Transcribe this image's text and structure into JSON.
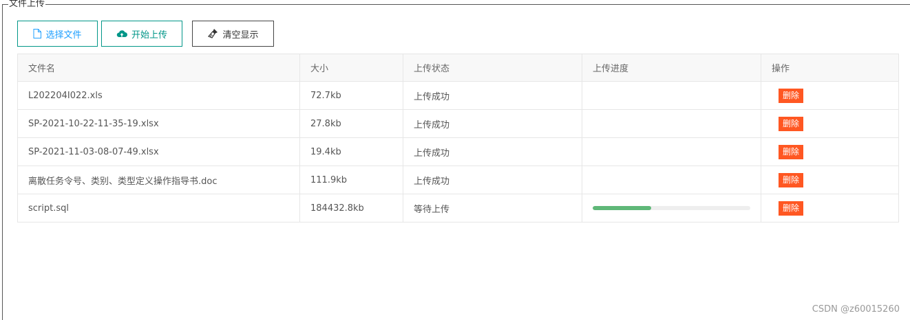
{
  "fieldset": {
    "legend": "文件上传"
  },
  "toolbar": {
    "select_label": "选择文件",
    "start_label": "开始上传",
    "clear_label": "清空显示"
  },
  "table": {
    "headers": [
      "文件名",
      "大小",
      "上传状态",
      "上传进度",
      "操作"
    ],
    "rows": [
      {
        "name": "L202204I022.xls",
        "size": "72.7kb",
        "status": "上传成功",
        "status_type": "success",
        "progress": null,
        "action": "删除"
      },
      {
        "name": "SP-2021-10-22-11-35-19.xlsx",
        "size": "27.8kb",
        "status": "上传成功",
        "status_type": "success",
        "progress": null,
        "action": "删除"
      },
      {
        "name": "SP-2021-11-03-08-07-49.xlsx",
        "size": "19.4kb",
        "status": "上传成功",
        "status_type": "success",
        "progress": null,
        "action": "删除"
      },
      {
        "name": "离散任务令号、类别、类型定义操作指导书.doc",
        "size": "111.9kb",
        "status": "上传成功",
        "status_type": "success",
        "progress": null,
        "action": "删除"
      },
      {
        "name": "script.sql",
        "size": "184432.8kb",
        "status": "等待上传",
        "status_type": "waiting",
        "progress": 0.37,
        "action": "删除"
      }
    ]
  },
  "colors": {
    "success": "#009f2e",
    "danger": "#ff5722",
    "progress": "#5fb878",
    "primary": "#009688",
    "link": "#1e9fff"
  },
  "icons": {
    "select": "file-icon",
    "start": "cloud-upload-icon",
    "clear": "brush-icon"
  },
  "watermark": "CSDN @z60015260"
}
